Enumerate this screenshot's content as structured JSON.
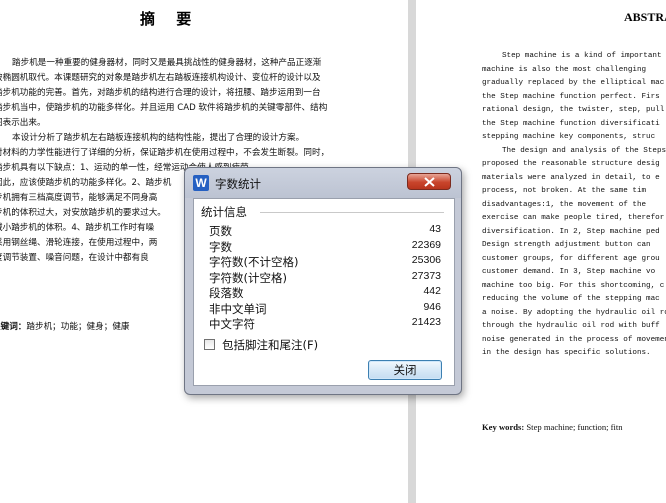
{
  "left_page": {
    "title": "摘 要",
    "lines": [
      "踏步机是一种重要的健身器材，同时又是最具挑战性的健身器材，这种产品正逐渐",
      "被椭圆机取代。本课题研究的对象是踏步机左右踏板连接机构设计、变位杆的设计以及",
      "踏步机功能的完善。首先，对踏步机的结构进行合理的设计，将扭腰、踏步运用到一台",
      "踏步机当中，使踏步机的功能多样化。并且运用 CAD 软件将踏步机的关键零部件、结构",
      "图表示出来。",
      "本设计分析了踏步机左右踏板连接机构的结构性能，提出了合理的设计方案。",
      "对材料的力学性能进行了详细的分析，保证踏步机在使用过程中，不会发生断裂。同时，",
      "踏步机具有以下缺点：1、运动的单一性，经常运动会使人感到疲劳，",
      "因此，应该使踏步机的功能多样化。2、踏步机",
      "步机拥有三档高度调节，能够满足不同身高",
      "步机的体积过大，对安放踏步机的要求过大。",
      "减小踏步机的体积。4、踏步机工作时有噪",
      "采用钢丝绳、滑轮连接，在使用过程中，两",
      "度调节装置、噪音问题，在设计中都有良"
    ],
    "keywords_label": "关键词：",
    "keywords": "踏步机；功能；健身；健康"
  },
  "right_page": {
    "title": "ABSTRACT",
    "lines": [
      "Step machine is a kind of important",
      "machine is also the most challenging",
      "gradually replaced by the elliptical mac",
      "the Step machine function perfect. Firs",
      "rational design, the twister, step, pull",
      "the Step machine function diversificati",
      "stepping machine key components, struc",
      "The design and analysis of the Steps",
      "proposed the reasonable structure desig",
      "materials were analyzed in detail, to e",
      "process, not broken. At the same tim",
      "disadvantages:1, the movement of the",
      "exercise can make people tired, therefor",
      "diversification. In 2, Step machine ped",
      "Design strength adjustment button can",
      "customer groups, for different age grou",
      "customer demand. In 3, Step machine vo",
      "machine too big. For this shortcoming, c",
      "reducing the volume of the stepping mac",
      "a noise. By adopting the hydraulic oil ro",
      "through the hydraulic oil rod with buff",
      "noise generated in the process of movemen",
      "in the design has specific solutions."
    ],
    "keywords_label": "Key words:",
    "keywords": "Step machine; function; fitn"
  },
  "dialog": {
    "app_icon_letter": "W",
    "title": "字数统计",
    "section_header": "统计信息",
    "stats": [
      {
        "label": "页数",
        "value": "43"
      },
      {
        "label": "字数",
        "value": "22369"
      },
      {
        "label": "字符数(不计空格)",
        "value": "25306"
      },
      {
        "label": "字符数(计空格)",
        "value": "27373"
      },
      {
        "label": "段落数",
        "value": "442"
      },
      {
        "label": "非中文单词",
        "value": "946"
      },
      {
        "label": "中文字符",
        "value": "21423"
      }
    ],
    "checkbox_label": "包括脚注和尾注(F)",
    "checkbox_checked": false,
    "ok_label": "关闭"
  },
  "colors": {
    "dialog_frame": "#c4c9d6",
    "close_button": "#c9452c",
    "ok_button_border": "#3c7fb1",
    "app_icon": "#2560c2"
  }
}
